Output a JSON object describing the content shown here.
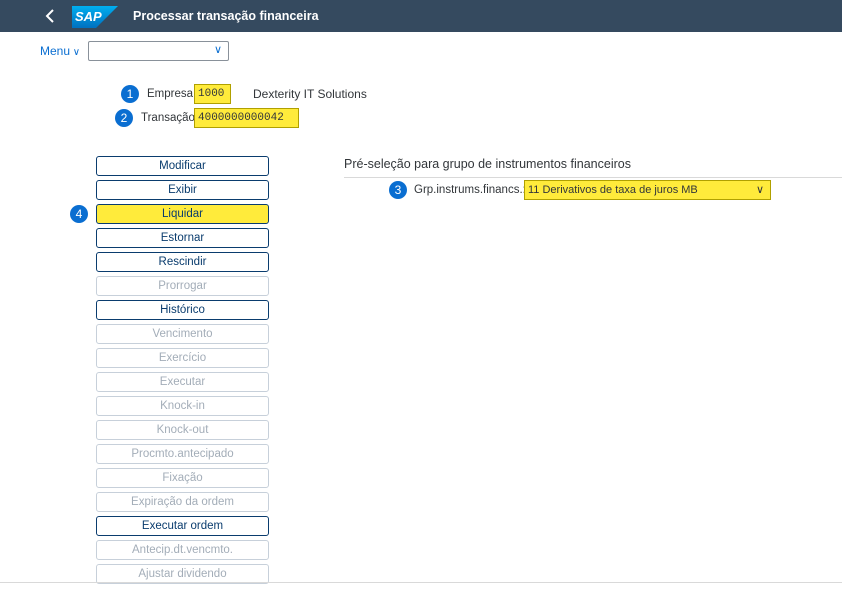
{
  "header": {
    "title": "Processar transação financeira",
    "logo_text": "SAP",
    "brand_color": "#354a5f"
  },
  "menu": {
    "label": "Menu",
    "selected": ""
  },
  "fields": {
    "empresa_label": "Empresa:",
    "empresa_value": "1000",
    "empresa_name": "Dexterity IT Solutions",
    "transacao_label": "Transação:",
    "transacao_value": "4000000000042"
  },
  "badges": [
    "1",
    "2",
    "3",
    "4"
  ],
  "buttons": [
    {
      "label": "Modificar",
      "enabled": true
    },
    {
      "label": "Exibir",
      "enabled": true
    },
    {
      "label": "Liquidar",
      "enabled": true,
      "highlighted": true
    },
    {
      "label": "Estornar",
      "enabled": true
    },
    {
      "label": "Rescindir",
      "enabled": true
    },
    {
      "label": "Prorrogar",
      "enabled": false
    },
    {
      "label": "Histórico",
      "enabled": true
    },
    {
      "label": "Vencimento",
      "enabled": false
    },
    {
      "label": "Exercício",
      "enabled": false
    },
    {
      "label": "Executar",
      "enabled": false
    },
    {
      "label": "Knock-in",
      "enabled": false
    },
    {
      "label": "Knock-out",
      "enabled": false
    },
    {
      "label": "Procmto.antecipado",
      "enabled": false
    },
    {
      "label": "Fixação",
      "enabled": false
    },
    {
      "label": "Expiração da ordem",
      "enabled": false
    },
    {
      "label": "Executar ordem",
      "enabled": true
    },
    {
      "label": "Antecip.dt.vencmto.",
      "enabled": false
    },
    {
      "label": "Ajustar dividendo",
      "enabled": false
    }
  ],
  "preselection": {
    "title": "Pré-seleção para grupo de instrumentos financeiros",
    "field_label": "Grp.instrums.financs.:",
    "required_mark": "*",
    "value": "11 Derivativos de taxa de juros MB"
  }
}
